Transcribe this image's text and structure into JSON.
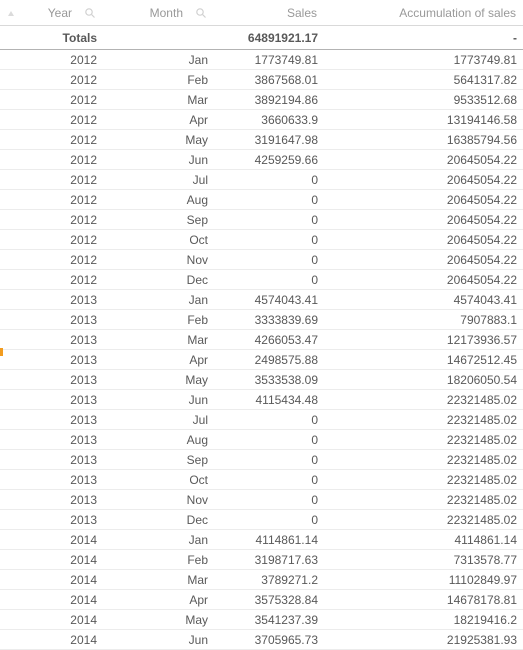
{
  "header": {
    "year": "Year",
    "month": "Month",
    "sales": "Sales",
    "accumulation": "Accumulation of sales"
  },
  "totals": {
    "label": "Totals",
    "sales": "64891921.17",
    "accumulation": "-"
  },
  "icons": {
    "sort": "sort-asc-icon",
    "search": "magnifier-icon"
  },
  "rows": [
    {
      "year": "2012",
      "month": "Jan",
      "sales": "1773749.81",
      "acc": "1773749.81"
    },
    {
      "year": "2012",
      "month": "Feb",
      "sales": "3867568.01",
      "acc": "5641317.82"
    },
    {
      "year": "2012",
      "month": "Mar",
      "sales": "3892194.86",
      "acc": "9533512.68"
    },
    {
      "year": "2012",
      "month": "Apr",
      "sales": "3660633.9",
      "acc": "13194146.58"
    },
    {
      "year": "2012",
      "month": "May",
      "sales": "3191647.98",
      "acc": "16385794.56"
    },
    {
      "year": "2012",
      "month": "Jun",
      "sales": "4259259.66",
      "acc": "20645054.22"
    },
    {
      "year": "2012",
      "month": "Jul",
      "sales": "0",
      "acc": "20645054.22"
    },
    {
      "year": "2012",
      "month": "Aug",
      "sales": "0",
      "acc": "20645054.22"
    },
    {
      "year": "2012",
      "month": "Sep",
      "sales": "0",
      "acc": "20645054.22"
    },
    {
      "year": "2012",
      "month": "Oct",
      "sales": "0",
      "acc": "20645054.22"
    },
    {
      "year": "2012",
      "month": "Nov",
      "sales": "0",
      "acc": "20645054.22"
    },
    {
      "year": "2012",
      "month": "Dec",
      "sales": "0",
      "acc": "20645054.22"
    },
    {
      "year": "2013",
      "month": "Jan",
      "sales": "4574043.41",
      "acc": "4574043.41"
    },
    {
      "year": "2013",
      "month": "Feb",
      "sales": "3333839.69",
      "acc": "7907883.1"
    },
    {
      "year": "2013",
      "month": "Mar",
      "sales": "4266053.47",
      "acc": "12173936.57"
    },
    {
      "year": "2013",
      "month": "Apr",
      "sales": "2498575.88",
      "acc": "14672512.45"
    },
    {
      "year": "2013",
      "month": "May",
      "sales": "3533538.09",
      "acc": "18206050.54"
    },
    {
      "year": "2013",
      "month": "Jun",
      "sales": "4115434.48",
      "acc": "22321485.02"
    },
    {
      "year": "2013",
      "month": "Jul",
      "sales": "0",
      "acc": "22321485.02"
    },
    {
      "year": "2013",
      "month": "Aug",
      "sales": "0",
      "acc": "22321485.02"
    },
    {
      "year": "2013",
      "month": "Sep",
      "sales": "0",
      "acc": "22321485.02"
    },
    {
      "year": "2013",
      "month": "Oct",
      "sales": "0",
      "acc": "22321485.02"
    },
    {
      "year": "2013",
      "month": "Nov",
      "sales": "0",
      "acc": "22321485.02"
    },
    {
      "year": "2013",
      "month": "Dec",
      "sales": "0",
      "acc": "22321485.02"
    },
    {
      "year": "2014",
      "month": "Jan",
      "sales": "4114861.14",
      "acc": "4114861.14"
    },
    {
      "year": "2014",
      "month": "Feb",
      "sales": "3198717.63",
      "acc": "7313578.77"
    },
    {
      "year": "2014",
      "month": "Mar",
      "sales": "3789271.2",
      "acc": "11102849.97"
    },
    {
      "year": "2014",
      "month": "Apr",
      "sales": "3575328.84",
      "acc": "14678178.81"
    },
    {
      "year": "2014",
      "month": "May",
      "sales": "3541237.39",
      "acc": "18219416.2"
    },
    {
      "year": "2014",
      "month": "Jun",
      "sales": "3705965.73",
      "acc": "21925381.93"
    }
  ]
}
